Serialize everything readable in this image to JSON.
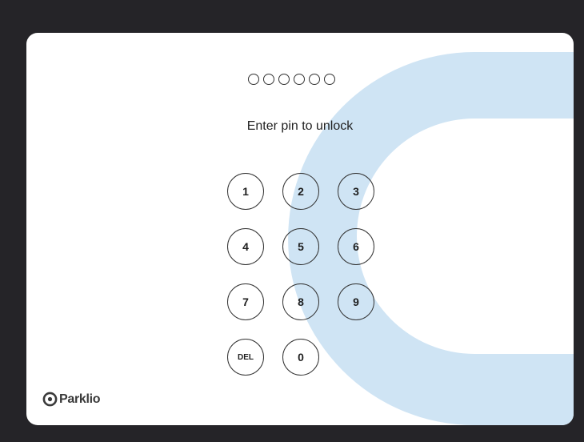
{
  "lock_screen": {
    "pin_length": 6,
    "pin_entered": 0,
    "prompt": "Enter pin to unlock",
    "keys": {
      "k1": "1",
      "k2": "2",
      "k3": "3",
      "k4": "4",
      "k5": "5",
      "k6": "6",
      "k7": "7",
      "k8": "8",
      "k9": "9",
      "del": "DEL",
      "k0": "0"
    }
  },
  "brand": {
    "name": "Parklio",
    "logo_icon": "parklio-logo-icon"
  },
  "colors": {
    "background": "#252428",
    "card": "#ffffff",
    "accent_shape": "#cfe4f4",
    "stroke": "#333333"
  }
}
